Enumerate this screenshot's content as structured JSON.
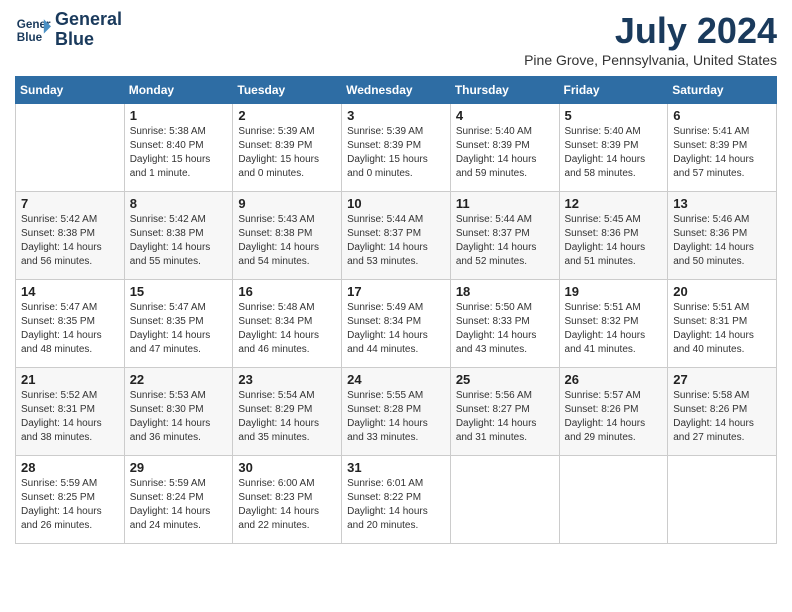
{
  "logo": {
    "line1": "General",
    "line2": "Blue"
  },
  "title": "July 2024",
  "location": "Pine Grove, Pennsylvania, United States",
  "days_of_week": [
    "Sunday",
    "Monday",
    "Tuesday",
    "Wednesday",
    "Thursday",
    "Friday",
    "Saturday"
  ],
  "weeks": [
    [
      {
        "day": "",
        "info": ""
      },
      {
        "day": "1",
        "info": "Sunrise: 5:38 AM\nSunset: 8:40 PM\nDaylight: 15 hours\nand 1 minute."
      },
      {
        "day": "2",
        "info": "Sunrise: 5:39 AM\nSunset: 8:39 PM\nDaylight: 15 hours\nand 0 minutes."
      },
      {
        "day": "3",
        "info": "Sunrise: 5:39 AM\nSunset: 8:39 PM\nDaylight: 15 hours\nand 0 minutes."
      },
      {
        "day": "4",
        "info": "Sunrise: 5:40 AM\nSunset: 8:39 PM\nDaylight: 14 hours\nand 59 minutes."
      },
      {
        "day": "5",
        "info": "Sunrise: 5:40 AM\nSunset: 8:39 PM\nDaylight: 14 hours\nand 58 minutes."
      },
      {
        "day": "6",
        "info": "Sunrise: 5:41 AM\nSunset: 8:39 PM\nDaylight: 14 hours\nand 57 minutes."
      }
    ],
    [
      {
        "day": "7",
        "info": "Sunrise: 5:42 AM\nSunset: 8:38 PM\nDaylight: 14 hours\nand 56 minutes."
      },
      {
        "day": "8",
        "info": "Sunrise: 5:42 AM\nSunset: 8:38 PM\nDaylight: 14 hours\nand 55 minutes."
      },
      {
        "day": "9",
        "info": "Sunrise: 5:43 AM\nSunset: 8:38 PM\nDaylight: 14 hours\nand 54 minutes."
      },
      {
        "day": "10",
        "info": "Sunrise: 5:44 AM\nSunset: 8:37 PM\nDaylight: 14 hours\nand 53 minutes."
      },
      {
        "day": "11",
        "info": "Sunrise: 5:44 AM\nSunset: 8:37 PM\nDaylight: 14 hours\nand 52 minutes."
      },
      {
        "day": "12",
        "info": "Sunrise: 5:45 AM\nSunset: 8:36 PM\nDaylight: 14 hours\nand 51 minutes."
      },
      {
        "day": "13",
        "info": "Sunrise: 5:46 AM\nSunset: 8:36 PM\nDaylight: 14 hours\nand 50 minutes."
      }
    ],
    [
      {
        "day": "14",
        "info": "Sunrise: 5:47 AM\nSunset: 8:35 PM\nDaylight: 14 hours\nand 48 minutes."
      },
      {
        "day": "15",
        "info": "Sunrise: 5:47 AM\nSunset: 8:35 PM\nDaylight: 14 hours\nand 47 minutes."
      },
      {
        "day": "16",
        "info": "Sunrise: 5:48 AM\nSunset: 8:34 PM\nDaylight: 14 hours\nand 46 minutes."
      },
      {
        "day": "17",
        "info": "Sunrise: 5:49 AM\nSunset: 8:34 PM\nDaylight: 14 hours\nand 44 minutes."
      },
      {
        "day": "18",
        "info": "Sunrise: 5:50 AM\nSunset: 8:33 PM\nDaylight: 14 hours\nand 43 minutes."
      },
      {
        "day": "19",
        "info": "Sunrise: 5:51 AM\nSunset: 8:32 PM\nDaylight: 14 hours\nand 41 minutes."
      },
      {
        "day": "20",
        "info": "Sunrise: 5:51 AM\nSunset: 8:31 PM\nDaylight: 14 hours\nand 40 minutes."
      }
    ],
    [
      {
        "day": "21",
        "info": "Sunrise: 5:52 AM\nSunset: 8:31 PM\nDaylight: 14 hours\nand 38 minutes."
      },
      {
        "day": "22",
        "info": "Sunrise: 5:53 AM\nSunset: 8:30 PM\nDaylight: 14 hours\nand 36 minutes."
      },
      {
        "day": "23",
        "info": "Sunrise: 5:54 AM\nSunset: 8:29 PM\nDaylight: 14 hours\nand 35 minutes."
      },
      {
        "day": "24",
        "info": "Sunrise: 5:55 AM\nSunset: 8:28 PM\nDaylight: 14 hours\nand 33 minutes."
      },
      {
        "day": "25",
        "info": "Sunrise: 5:56 AM\nSunset: 8:27 PM\nDaylight: 14 hours\nand 31 minutes."
      },
      {
        "day": "26",
        "info": "Sunrise: 5:57 AM\nSunset: 8:26 PM\nDaylight: 14 hours\nand 29 minutes."
      },
      {
        "day": "27",
        "info": "Sunrise: 5:58 AM\nSunset: 8:26 PM\nDaylight: 14 hours\nand 27 minutes."
      }
    ],
    [
      {
        "day": "28",
        "info": "Sunrise: 5:59 AM\nSunset: 8:25 PM\nDaylight: 14 hours\nand 26 minutes."
      },
      {
        "day": "29",
        "info": "Sunrise: 5:59 AM\nSunset: 8:24 PM\nDaylight: 14 hours\nand 24 minutes."
      },
      {
        "day": "30",
        "info": "Sunrise: 6:00 AM\nSunset: 8:23 PM\nDaylight: 14 hours\nand 22 minutes."
      },
      {
        "day": "31",
        "info": "Sunrise: 6:01 AM\nSunset: 8:22 PM\nDaylight: 14 hours\nand 20 minutes."
      },
      {
        "day": "",
        "info": ""
      },
      {
        "day": "",
        "info": ""
      },
      {
        "day": "",
        "info": ""
      }
    ]
  ]
}
